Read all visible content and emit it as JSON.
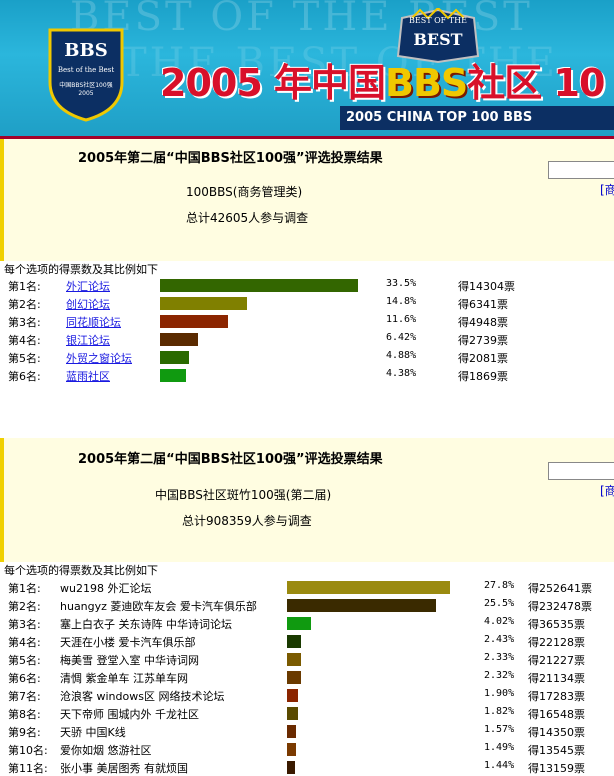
{
  "banner": {
    "logo_top": "BBS",
    "logo_line1": "Best of the Best",
    "logo_line2": "中国BBS社区100强",
    "logo_line3": "2005",
    "badge_top": "BEST OF THE",
    "badge_main": "BEST",
    "headline_a": "2005 年中国",
    "headline_b": "BBS",
    "headline_c": "社区 10",
    "subline": "2005 CHINA TOP 100 BBS"
  },
  "colors": {
    "banner_bg": "#1fa8d0",
    "panel_bg": "#fffde1",
    "link": "#1a1ae0",
    "headline": "#d8102a"
  },
  "poll1": {
    "title": "2005年第二届“中国BBS社区100强”评选投票结果",
    "category": "100BBS(商务管理类)",
    "total": "总计42605人参与调查",
    "bracket": "[商",
    "caption": "每个选项的得票数及其比例如下",
    "rows": [
      {
        "rank": "第1名:",
        "name": "外汇论坛",
        "pct_label": "33.5%",
        "pct": 33.5,
        "votes": "得14304票",
        "color": "#336600"
      },
      {
        "rank": "第2名:",
        "name": "创幻论坛",
        "pct_label": "14.8%",
        "pct": 14.8,
        "votes": "得6341票",
        "color": "#808000"
      },
      {
        "rank": "第3名:",
        "name": "同花顺论坛",
        "pct_label": "11.6%",
        "pct": 11.6,
        "votes": "得4948票",
        "color": "#8b2500"
      },
      {
        "rank": "第4名:",
        "name": "银江论坛",
        "pct_label": "6.42%",
        "pct": 6.42,
        "votes": "得2739票",
        "color": "#5a2a00"
      },
      {
        "rank": "第5名:",
        "name": "外贸之窗论坛",
        "pct_label": "4.88%",
        "pct": 4.88,
        "votes": "得2081票",
        "color": "#2a6a00"
      },
      {
        "rank": "第6名:",
        "name": "蓝雨社区",
        "pct_label": "4.38%",
        "pct": 4.38,
        "votes": "得1869票",
        "color": "#109a10"
      }
    ]
  },
  "poll2": {
    "title": "2005年第二届“中国BBS社区100强”评选投票结果",
    "category": "中国BBS社区斑竹100强(第二届)",
    "total": "总计908359人参与调查",
    "bracket": "[商",
    "caption": "每个选项的得票数及其比例如下",
    "rows": [
      {
        "rank": "第1名:",
        "name": "wu2198 外汇论坛",
        "pct_label": "27.8%",
        "pct": 27.8,
        "votes": "得252641票",
        "color": "#9a8a10"
      },
      {
        "rank": "第2名:",
        "name": "huangyz 菱迪欧车友会 爱卡汽车俱乐部",
        "pct_label": "25.5%",
        "pct": 25.5,
        "votes": "得232478票",
        "color": "#3a2a00"
      },
      {
        "rank": "第3名:",
        "name": "塞上白衣子 关东诗阵 中华诗词论坛",
        "pct_label": "4.02%",
        "pct": 4.02,
        "votes": "得36535票",
        "color": "#109a10"
      },
      {
        "rank": "第4名:",
        "name": "天涯在小楼 爱卡汽车俱乐部",
        "pct_label": "2.43%",
        "pct": 2.43,
        "votes": "得22128票",
        "color": "#1a3a00"
      },
      {
        "rank": "第5名:",
        "name": "梅美雪 登堂入室 中华诗词网",
        "pct_label": "2.33%",
        "pct": 2.33,
        "votes": "得21227票",
        "color": "#7a5a00"
      },
      {
        "rank": "第6名:",
        "name": "清惆 紫金单车 江苏单车网",
        "pct_label": "2.32%",
        "pct": 2.32,
        "votes": "得21134票",
        "color": "#6a3a00"
      },
      {
        "rank": "第7名:",
        "name": "沧浪客 windows区 网络技术论坛",
        "pct_label": "1.90%",
        "pct": 1.9,
        "votes": "得17283票",
        "color": "#8b2500"
      },
      {
        "rank": "第8名:",
        "name": "天下帝师 围城内外 千龙社区",
        "pct_label": "1.82%",
        "pct": 1.82,
        "votes": "得16548票",
        "color": "#5a4a00"
      },
      {
        "rank": "第9名:",
        "name": "天骄 中国K线",
        "pct_label": "1.57%",
        "pct": 1.57,
        "votes": "得14350票",
        "color": "#6a2a00"
      },
      {
        "rank": "第10名:",
        "name": "爱你如烟 悠游社区",
        "pct_label": "1.49%",
        "pct": 1.49,
        "votes": "得13545票",
        "color": "#7a3a00"
      },
      {
        "rank": "第11名:",
        "name": "张小事 美居图秀 有就烦国",
        "pct_label": "1.44%",
        "pct": 1.44,
        "votes": "得13159票",
        "color": "#3a1a00"
      }
    ]
  }
}
